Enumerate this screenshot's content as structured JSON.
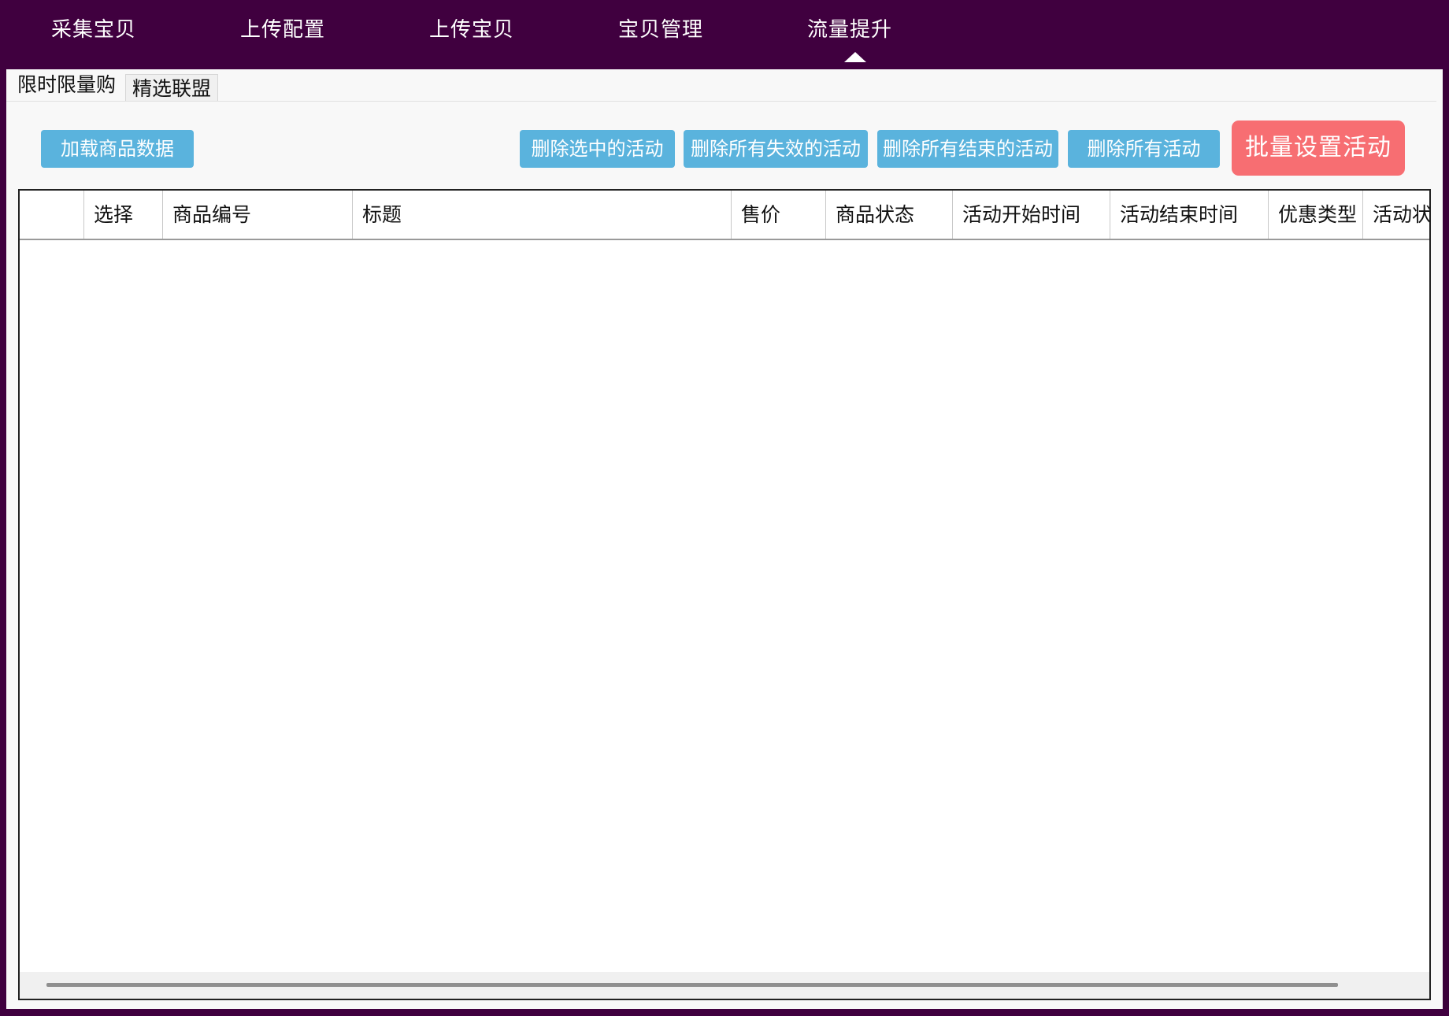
{
  "nav": {
    "items": [
      {
        "label": "采集宝贝"
      },
      {
        "label": "上传配置"
      },
      {
        "label": "上传宝贝"
      },
      {
        "label": "宝贝管理"
      },
      {
        "label": "流量提升"
      }
    ],
    "active_index": 4
  },
  "subtabs": {
    "items": [
      {
        "label": "限时限量购"
      },
      {
        "label": "精选联盟"
      }
    ],
    "active_index": 0
  },
  "toolbar": {
    "load_button": "加载商品数据",
    "delete_selected": "删除选中的活动",
    "delete_invalid": "删除所有失效的活动",
    "delete_ended": "删除所有结束的活动",
    "delete_all": "删除所有活动",
    "batch_set": "批量设置活动"
  },
  "colors": {
    "nav_bg": "#40003f",
    "primary_button": "#5ab3dd",
    "danger_button": "#f76e72"
  },
  "table": {
    "columns": [
      {
        "label": ""
      },
      {
        "label": "选择"
      },
      {
        "label": "商品编号"
      },
      {
        "label": "标题"
      },
      {
        "label": "售价"
      },
      {
        "label": "商品状态"
      },
      {
        "label": "活动开始时间"
      },
      {
        "label": "活动结束时间"
      },
      {
        "label": "优惠类型"
      },
      {
        "label": "活动状态"
      }
    ],
    "rows": []
  }
}
